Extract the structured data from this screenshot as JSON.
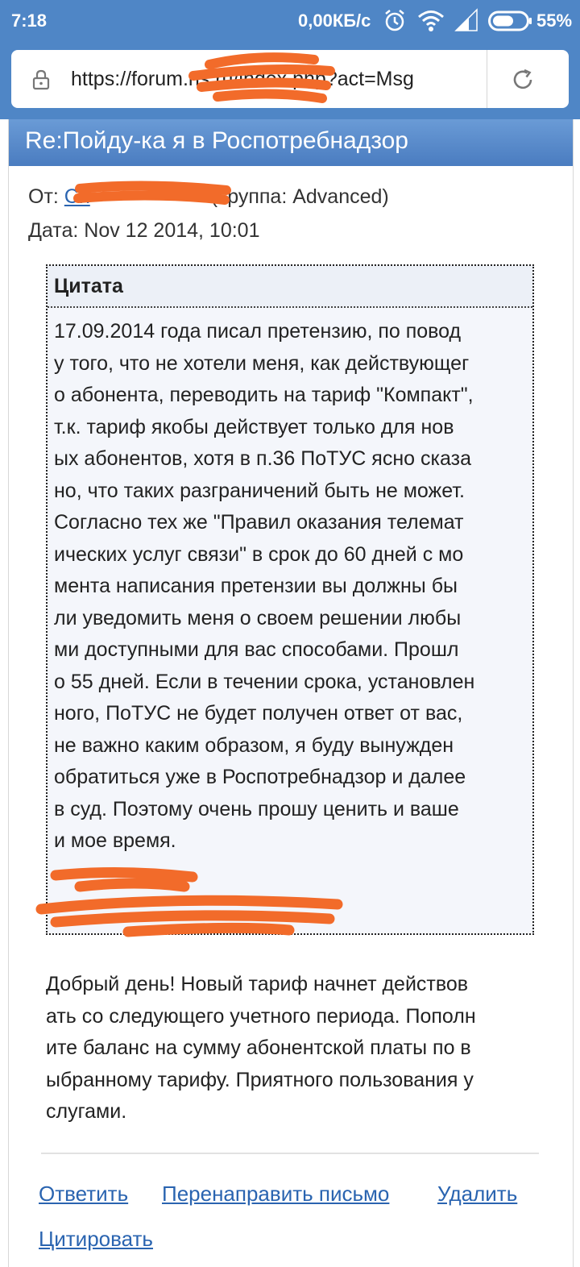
{
  "status_bar": {
    "time": "7:18",
    "speed": "0,00КБ/с",
    "battery": "55%",
    "icons": [
      "alarm-icon",
      "wifi-icon",
      "signal-icon",
      "battery-icon"
    ]
  },
  "browser": {
    "url": "https://forum.ns    ru/index.php?act=Msg",
    "lock_icon": "lock-icon",
    "reload_icon": "reload-icon"
  },
  "message": {
    "title": "Re:Пойду-ка я в Роспотребнадзор",
    "from_label": "От:",
    "from_name": "Ch",
    "from_group": "(Группа: Advanced)",
    "date_label": "Дата:",
    "date_value": "Nov 12 2014, 10:01"
  },
  "quote": {
    "title": "Цитата",
    "lines": [
      "17.09.2014 года писал претензию, по повод",
      "у того, что не хотели меня, как действующег",
      "о абонента, переводить на тариф \"Компакт\",",
      "т.к. тариф якобы действует только для нов",
      "ых абонентов, хотя в п.36 ПоТУС ясно сказа",
      "но, что таких разграничений быть не может.",
      "Согласно тех же \"Правил оказания телемат",
      "ических услуг связи\" в срок до 60 дней с мо",
      "мента написания претензии вы должны бы",
      "ли уведомить меня о своем решении любы",
      "ми доступными для вас способами. Прошл",
      "о 55 дней. Если в течении срока, установлен",
      "ного, ПоТУС не будет получен ответ от вас,",
      "не важно каким образом, я буду вынужден",
      "обратиться уже в Роспотребнадзор и далее",
      "в суд. Поэтому очень прошу ценить и ваше",
      "и мое время."
    ]
  },
  "reply": {
    "lines": [
      "Добрый день! Новый тариф начнет действов",
      "ать со следующего учетного периода. Пополн",
      "ите баланс на сумму абонентской платы по в",
      "ыбранному тарифу. Приятного пользования у",
      "слугами."
    ]
  },
  "actions": {
    "reply": "Ответить",
    "forward": "Перенаправить письмо",
    "delete": "Удалить",
    "quote": "Цитировать"
  },
  "colors": {
    "status_bar": "#4f86c6",
    "title_bar": "#4a7cc0",
    "link": "#2a64b0",
    "quote_bg": "#f4f6fb",
    "redaction": "#f26b2a"
  }
}
